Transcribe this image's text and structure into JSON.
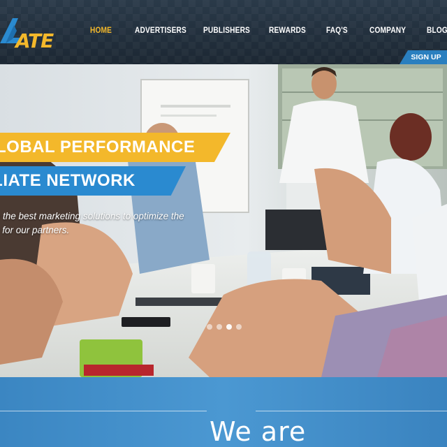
{
  "brand": {
    "logo_text": "ATE",
    "accent": "#f3b82b",
    "blue": "#2a8ad0"
  },
  "nav": {
    "items": [
      {
        "label": "HOME",
        "active": true
      },
      {
        "label": "ADVERTISERS",
        "active": false
      },
      {
        "label": "PUBLISHERS",
        "active": false
      },
      {
        "label": "REWARDS",
        "active": false
      },
      {
        "label": "FAQ'S",
        "active": false
      },
      {
        "label": "COMPANY",
        "active": false
      },
      {
        "label": "BLOG",
        "active": false
      }
    ],
    "signup": "SIGN UP"
  },
  "hero": {
    "line1": "LOBAL PERFORMANCE",
    "line2": "ILIATE NETWORK",
    "subtitle_line1": "ve the best marketing solutions to optimize the",
    "subtitle_line2": "ss for our partners.",
    "slides": 4,
    "active_slide": 2
  },
  "about": {
    "heading": "We are"
  }
}
